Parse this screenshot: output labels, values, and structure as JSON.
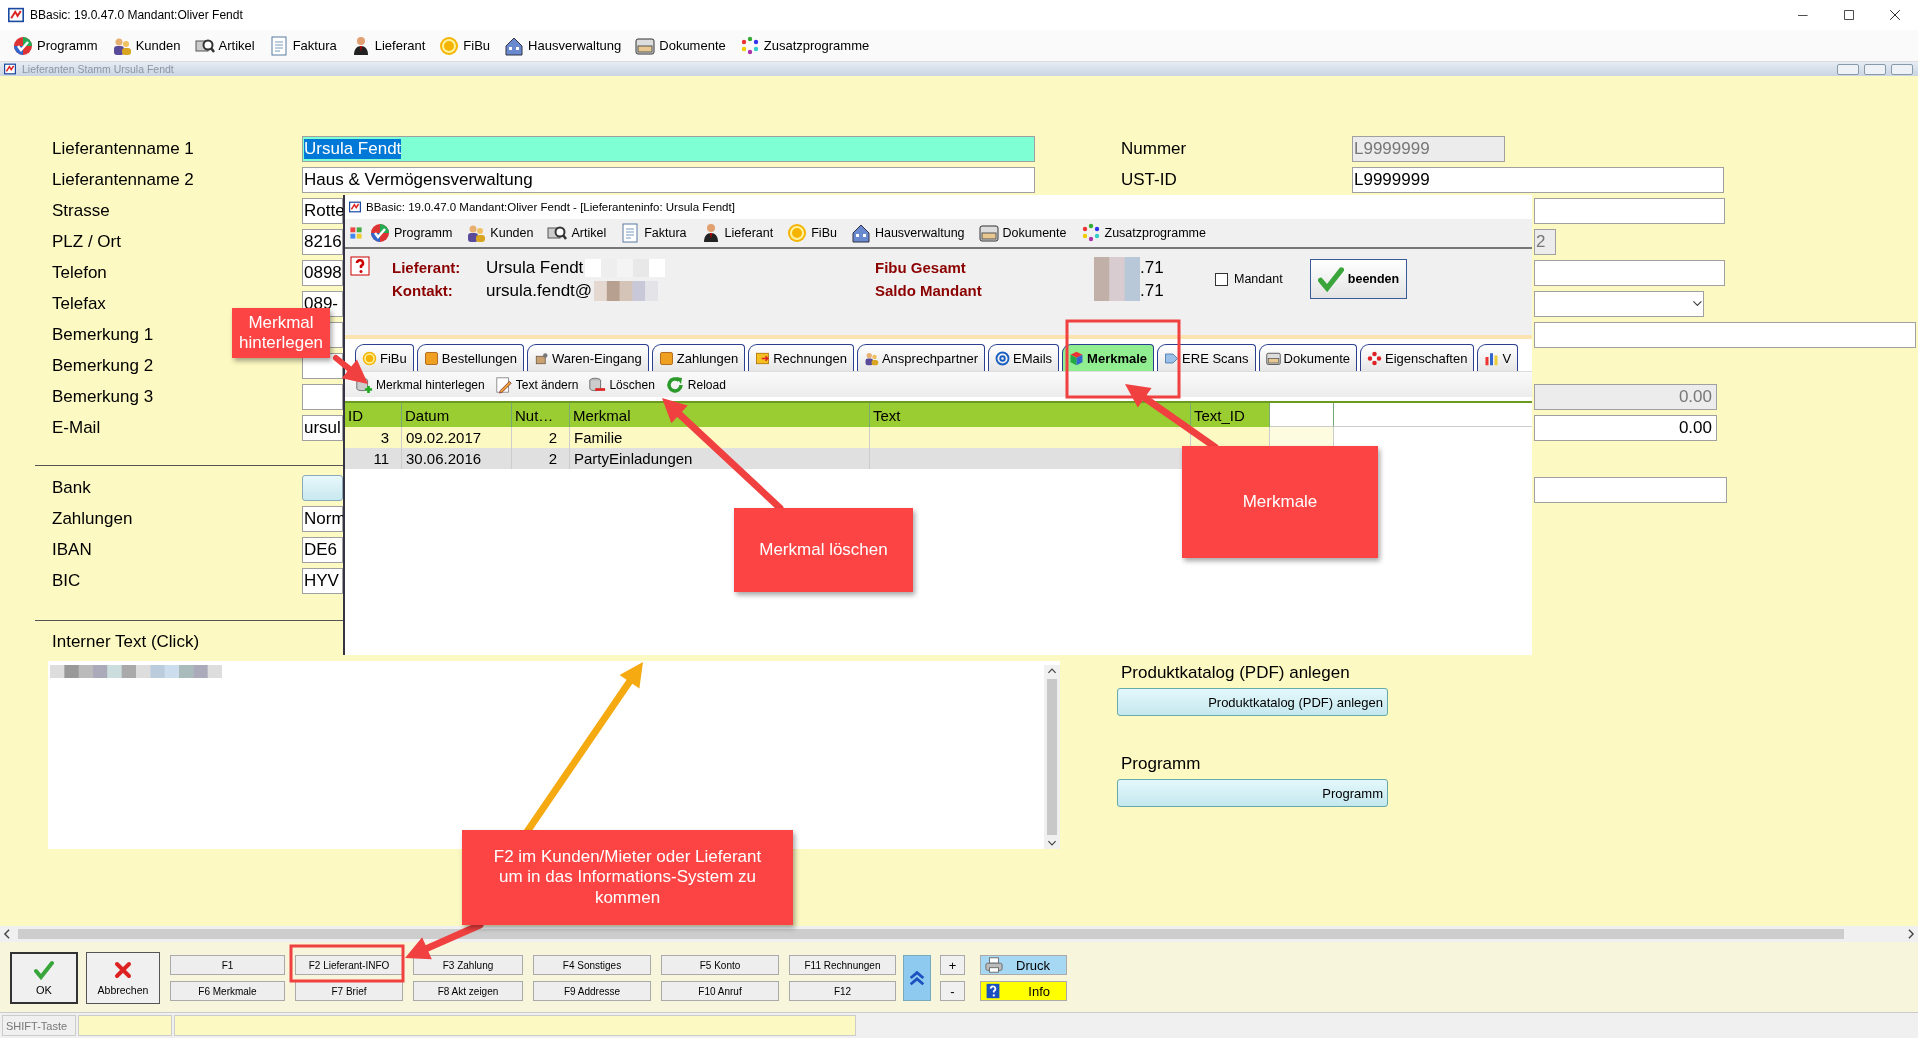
{
  "window": {
    "title": "BBasic: 19.0.47.0 Mandant:Oliver Fendt"
  },
  "menu": [
    {
      "label": "Programm"
    },
    {
      "label": "Kunden"
    },
    {
      "label": "Artikel"
    },
    {
      "label": "Faktura"
    },
    {
      "label": "Lieferant"
    },
    {
      "label": "FiBu"
    },
    {
      "label": "Hausverwaltung"
    },
    {
      "label": "Dokumente"
    },
    {
      "label": "Zusatzprogramme"
    }
  ],
  "child_window": {
    "title": "Lieferanten Stamm Ursula Fendt"
  },
  "form": {
    "left_fields": [
      {
        "kind": "field",
        "label": "Lieferantenname 1",
        "value": "Ursula Fendt",
        "selected": true
      },
      {
        "kind": "field",
        "label": "Lieferantenname 2",
        "value": "Haus & Vermögensverwaltung",
        "selected": false
      },
      {
        "kind": "field",
        "label": "Strasse",
        "value": "Rotte",
        "selected": false
      },
      {
        "kind": "field",
        "label": "PLZ / Ort",
        "value": "8216",
        "selected": false
      },
      {
        "kind": "field",
        "label": "Telefon",
        "value": "0898",
        "selected": false
      },
      {
        "kind": "field",
        "label": "Telefax",
        "value": "089-",
        "selected": false
      },
      {
        "kind": "field",
        "label": "Bemerkung 1",
        "selected": false
      },
      {
        "kind": "field",
        "label": "Bemerkung 2",
        "selected": false
      },
      {
        "kind": "field",
        "label": "Bemerkung 3",
        "selected": false
      },
      {
        "kind": "field",
        "label": "E-Mail",
        "value": "ursul",
        "selected": false
      }
    ],
    "bank_fields": [
      {
        "kind": "button",
        "label": "Bank"
      },
      {
        "kind": "field",
        "label": "Zahlungen",
        "value": "Norm"
      },
      {
        "kind": "field",
        "label": "IBAN",
        "value": "DE6"
      },
      {
        "kind": "field",
        "label": "BIC",
        "value": "HYV"
      }
    ],
    "internal_text": {
      "label": "Interner Text (Click)"
    },
    "right_fields": [
      {
        "kind": "field",
        "label": "Nummer",
        "value": "L9999999",
        "disabled": true
      },
      {
        "kind": "field",
        "label": "UST-ID",
        "value": "L9999999",
        "disabled": false
      },
      {
        "kind": "field",
        "disabled": false
      },
      {
        "kind": "field",
        "value": "2",
        "disabled": true
      },
      {
        "kind": "field",
        "disabled": false
      },
      {
        "kind": "dropdown",
        "disabled": false
      },
      {
        "kind": "field",
        "disabled": false
      },
      {
        "kind": "spacer"
      },
      {
        "kind": "field",
        "value": "0.00",
        "disabled": true
      },
      {
        "kind": "field",
        "value": "0.00",
        "disabled": false
      },
      {
        "kind": "spacer"
      },
      {
        "kind": "field",
        "disabled": false
      }
    ],
    "catalog": {
      "label": "Produktkatalog (PDF) anlegen",
      "button": "Produktkatalog (PDF) anlegen"
    },
    "program": {
      "label": "Programm",
      "button": "Programm"
    }
  },
  "info_window": {
    "title": "BBasic: 19.0.47.0 Mandant:Oliver Fendt  - [Lieferanteninfo: Ursula Fendt]",
    "menu": [
      {
        "label": "Programm"
      },
      {
        "label": "Kunden"
      },
      {
        "label": "Artikel"
      },
      {
        "label": "Faktura"
      },
      {
        "label": "Lieferant"
      },
      {
        "label": "FiBu"
      },
      {
        "label": "Hausverwaltung"
      },
      {
        "label": "Dokumente"
      },
      {
        "label": "Zusatzprogramme"
      }
    ],
    "supplier_label": "Lieferant:",
    "supplier": "Ursula Fendt",
    "contact_label": "Kontakt:",
    "contact": "ursula.fendt@",
    "fibu_total_label": "Fibu Gesamt",
    "balance_label": "Saldo Mandant",
    "fibu_total": ".71",
    "balance": ".71",
    "mandant": {
      "label": "Mandant",
      "checked": false
    },
    "close_button": "beenden",
    "tabs": [
      {
        "label": "FiBu",
        "selected": false
      },
      {
        "label": "Bestellungen",
        "selected": false
      },
      {
        "label": "Waren-Eingang",
        "selected": false
      },
      {
        "label": "Zahlungen",
        "selected": false
      },
      {
        "label": "Rechnungen",
        "selected": false
      },
      {
        "label": "Ansprechpartner",
        "selected": false
      },
      {
        "label": "EMails",
        "selected": false
      },
      {
        "label": "Merkmale",
        "selected": true
      },
      {
        "label": "ERE Scans",
        "selected": false
      },
      {
        "label": "Dokumente",
        "selected": false
      },
      {
        "label": "Eigenschaften",
        "selected": false
      },
      {
        "label": "V",
        "selected": false
      }
    ],
    "toolbar": [
      {
        "label": "Merkmal hinterlegen"
      },
      {
        "label": "Text ändern"
      },
      {
        "label": "Löschen"
      },
      {
        "label": "Reload"
      }
    ],
    "table": {
      "columns": [
        "ID",
        "Datum",
        "Nut…",
        "Merkmal",
        "Text",
        "Text_ID"
      ],
      "rows": [
        {
          "cells": [
            "3",
            "09.02.2017",
            "2",
            "Familie"
          ]
        },
        {
          "cells": [
            "11",
            "30.06.2016",
            "2",
            "PartyEinladungen"
          ]
        }
      ]
    }
  },
  "function_bar": {
    "ok": "OK",
    "cancel": "Abbrechen",
    "keys_top": [
      "F1",
      "F2 Lieferant-INFO",
      "F3 Zahlung",
      "F4 Sonstiges",
      "F5 Konto",
      "F11 Rechnungen"
    ],
    "keys_bottom": [
      "F6 Merkmale",
      "F7 Brief",
      "F8 Akt zeigen",
      "F9 Addresse",
      "F10 Anruf",
      "F12"
    ],
    "plus": "+",
    "minus": "-",
    "print": "Druck",
    "info": "Info"
  },
  "status_bar": {
    "hint": "SHIFT-Taste"
  },
  "annotations": [
    {
      "text": "Merkmal hinterlegen"
    },
    {
      "text": "Merkmal löschen"
    },
    {
      "text": "Merkmale"
    },
    {
      "text": "F2 im Kunden/Mieter oder Lieferant um in das Informations-System zu kommen"
    }
  ]
}
